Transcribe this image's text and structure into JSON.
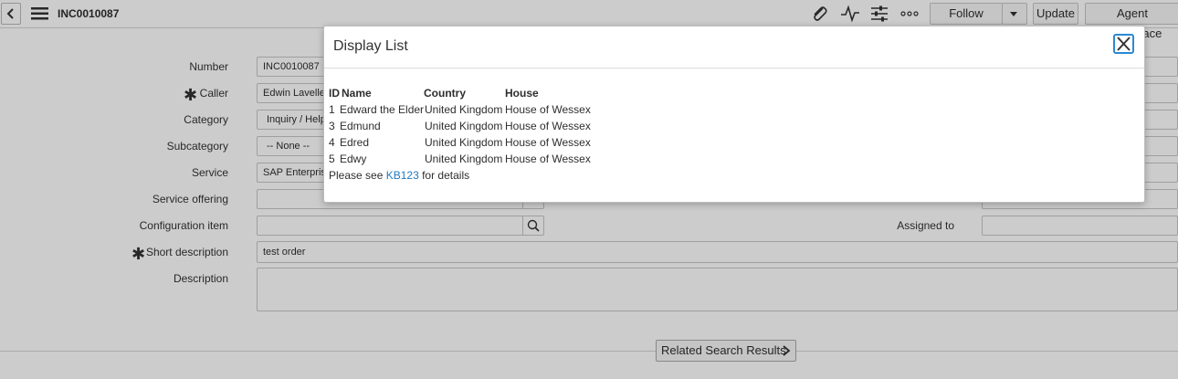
{
  "header": {
    "record_number": "INC0010087",
    "follow_label": "Follow",
    "update_label": "Update",
    "agent_workspace_label": "Agent Workspace"
  },
  "form": {
    "left_fields": [
      {
        "label": "Number",
        "value": "INC0010087",
        "required": false
      },
      {
        "label": "Caller",
        "value": "Edwin Lavelle",
        "required": true
      },
      {
        "label": "Category",
        "value": "Inquiry / Help",
        "required": false
      },
      {
        "label": "Subcategory",
        "value": "-- None --",
        "required": false
      },
      {
        "label": "Service",
        "value": "SAP Enterprise Services",
        "required": false
      },
      {
        "label": "Service offering",
        "value": "",
        "required": false
      },
      {
        "label": "Configuration item",
        "value": "",
        "required": false
      }
    ],
    "assigned_to_label": "Assigned to",
    "assigned_to_value": "",
    "short_description_label": "Short description",
    "short_description_value": "test order",
    "description_label": "Description",
    "description_value": ""
  },
  "related_search_label": "Related Search Results",
  "modal": {
    "title": "Display List",
    "columns": [
      "ID",
      "Name",
      "Country",
      "House"
    ],
    "rows": [
      {
        "id": "1",
        "name": "Edward the Elder",
        "country": "United Kingdom",
        "house": "House of Wessex"
      },
      {
        "id": "3",
        "name": "Edmund",
        "country": "United Kingdom",
        "house": "House of Wessex"
      },
      {
        "id": "4",
        "name": "Edred",
        "country": "United Kingdom",
        "house": "House of Wessex"
      },
      {
        "id": "5",
        "name": "Edwy",
        "country": "United Kingdom",
        "house": "House of Wessex"
      }
    ],
    "footer_prefix": "Please see",
    "footer_link": "KB123",
    "footer_suffix": "for details"
  },
  "colors": {
    "link": "#1f7ac2",
    "close_focus": "#2a8ad4",
    "overlay": "rgba(0,0,0,0.2)"
  }
}
